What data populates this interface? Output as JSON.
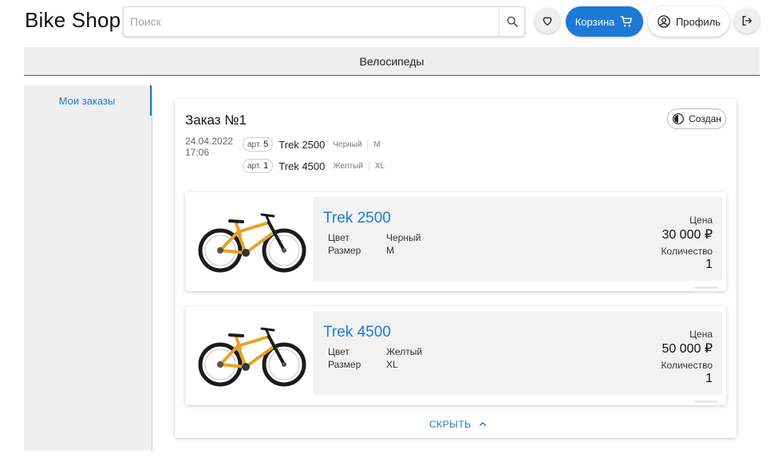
{
  "app": {
    "title": "Bike Shop"
  },
  "search": {
    "placeholder": "Поиск",
    "value": ""
  },
  "header": {
    "favorites_icon": "heart-icon",
    "cart_label": "Корзина",
    "profile_label": "Профиль",
    "logout_icon": "logout-icon"
  },
  "nav": {
    "category": "Велосипеды"
  },
  "sidebar": {
    "items": [
      {
        "label": "Мои заказы",
        "active": true
      }
    ]
  },
  "order": {
    "title": "Заказ №1",
    "status": "Создан",
    "date": "24.04.2022",
    "time": "17:06",
    "summary": [
      {
        "sku_prefix": "арт.",
        "sku_qty": "5",
        "name": "Trek 2500",
        "color": "Черный",
        "size": "M"
      },
      {
        "sku_prefix": "арт.",
        "sku_qty": "1",
        "name": "Trek 4500",
        "color": "Желтый",
        "size": "XL"
      }
    ],
    "items": [
      {
        "name": "Trek 2500",
        "color_label": "Цвет",
        "color": "Черный",
        "size_label": "Размер",
        "size": "M",
        "price_label": "Цена",
        "price": "30 000 ₽",
        "qty_label": "Количество",
        "qty": "1"
      },
      {
        "name": "Trek 4500",
        "color_label": "Цвет",
        "color": "Желтый",
        "size_label": "Размер",
        "size": "XL",
        "price_label": "Цена",
        "price": "50 000 ₽",
        "qty_label": "Количество",
        "qty": "1"
      }
    ],
    "hide_label": "СКРЫТЬ"
  },
  "colors": {
    "accent": "#1e78d6",
    "bike_frame": "#e8a126"
  }
}
